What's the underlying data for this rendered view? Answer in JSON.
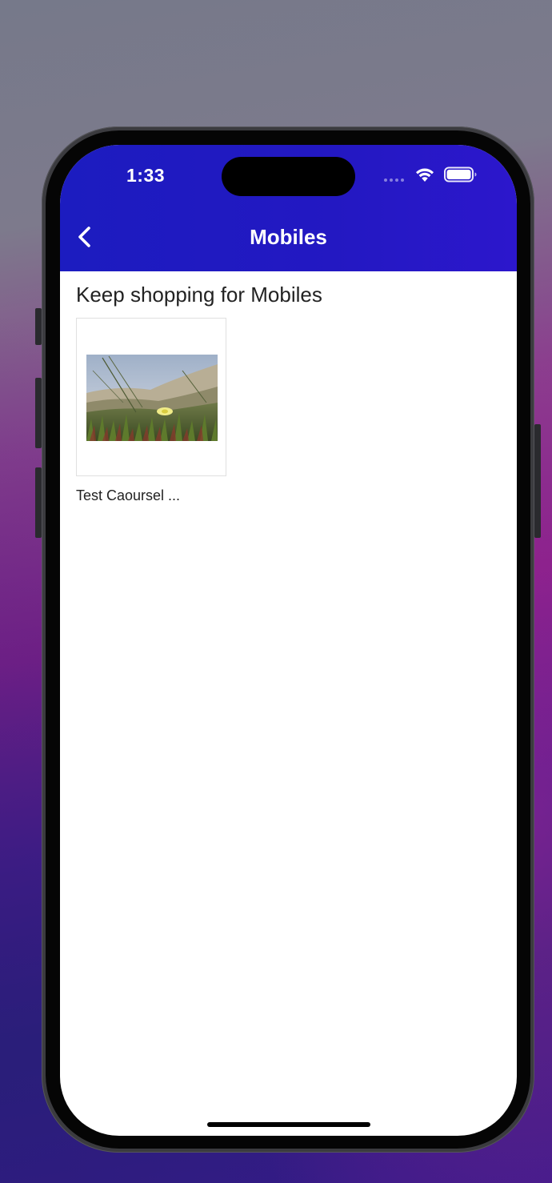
{
  "status_bar": {
    "time": "1:33",
    "icons": [
      "cellular-dots-icon",
      "wifi-icon",
      "battery-icon"
    ]
  },
  "header": {
    "title": "Mobiles",
    "back_icon": "chevron-left-icon",
    "background_color": "#2318c2"
  },
  "main": {
    "section_title": "Keep shopping for Mobiles",
    "products": [
      {
        "name": "Test Caoursel ...",
        "image": "dune-grass-photo"
      }
    ]
  }
}
